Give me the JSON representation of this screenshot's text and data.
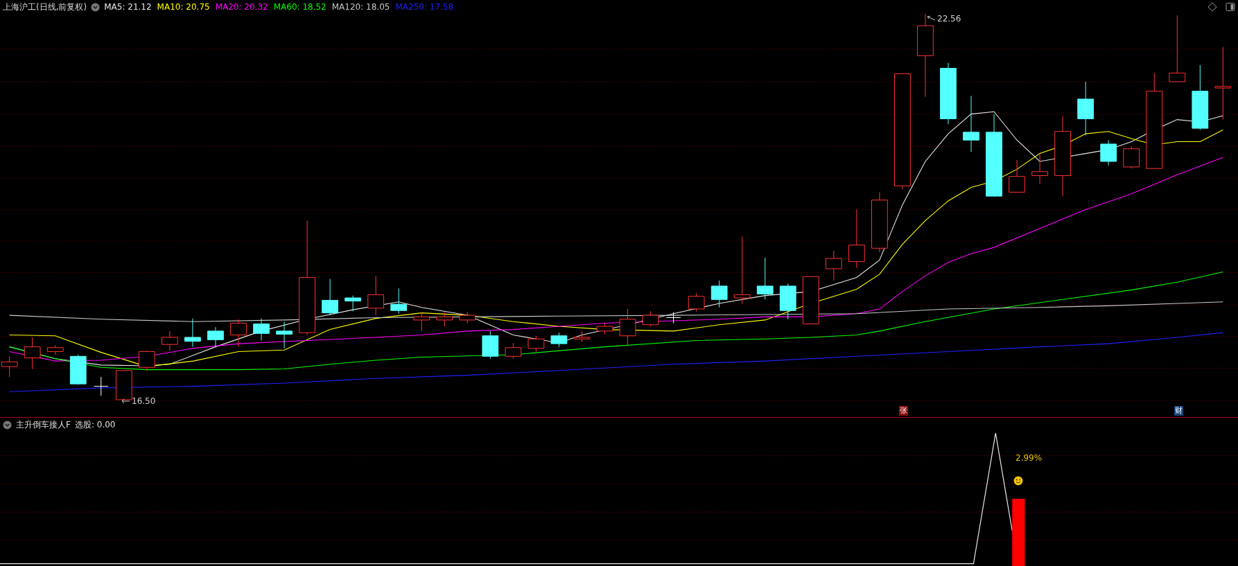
{
  "header": {
    "title": "上海沪工(日线,前复权)",
    "ma_legend": [
      {
        "label": "MA5: 21.12",
        "color": "#e8e8e8"
      },
      {
        "label": "MA10: 20.75",
        "color": "#ffff00"
      },
      {
        "label": "MA20: 20.32",
        "color": "#ff00ff"
      },
      {
        "label": "MA60: 18.52",
        "color": "#00ff00"
      },
      {
        "label": "MA120: 18.05",
        "color": "#c8c8c8"
      },
      {
        "label": "MA250: 17.58",
        "color": "#2020ff"
      }
    ]
  },
  "main_pane": {
    "high_label": "22.56",
    "low_label": "16.50",
    "badges": [
      {
        "text": "张",
        "color": "#8c0a0a"
      },
      {
        "text": "财",
        "color": "#16477a"
      }
    ]
  },
  "indicator": {
    "name": "主升倒车接人F",
    "reading": "选股: 0.00",
    "signal_label": "2.99%"
  }
}
